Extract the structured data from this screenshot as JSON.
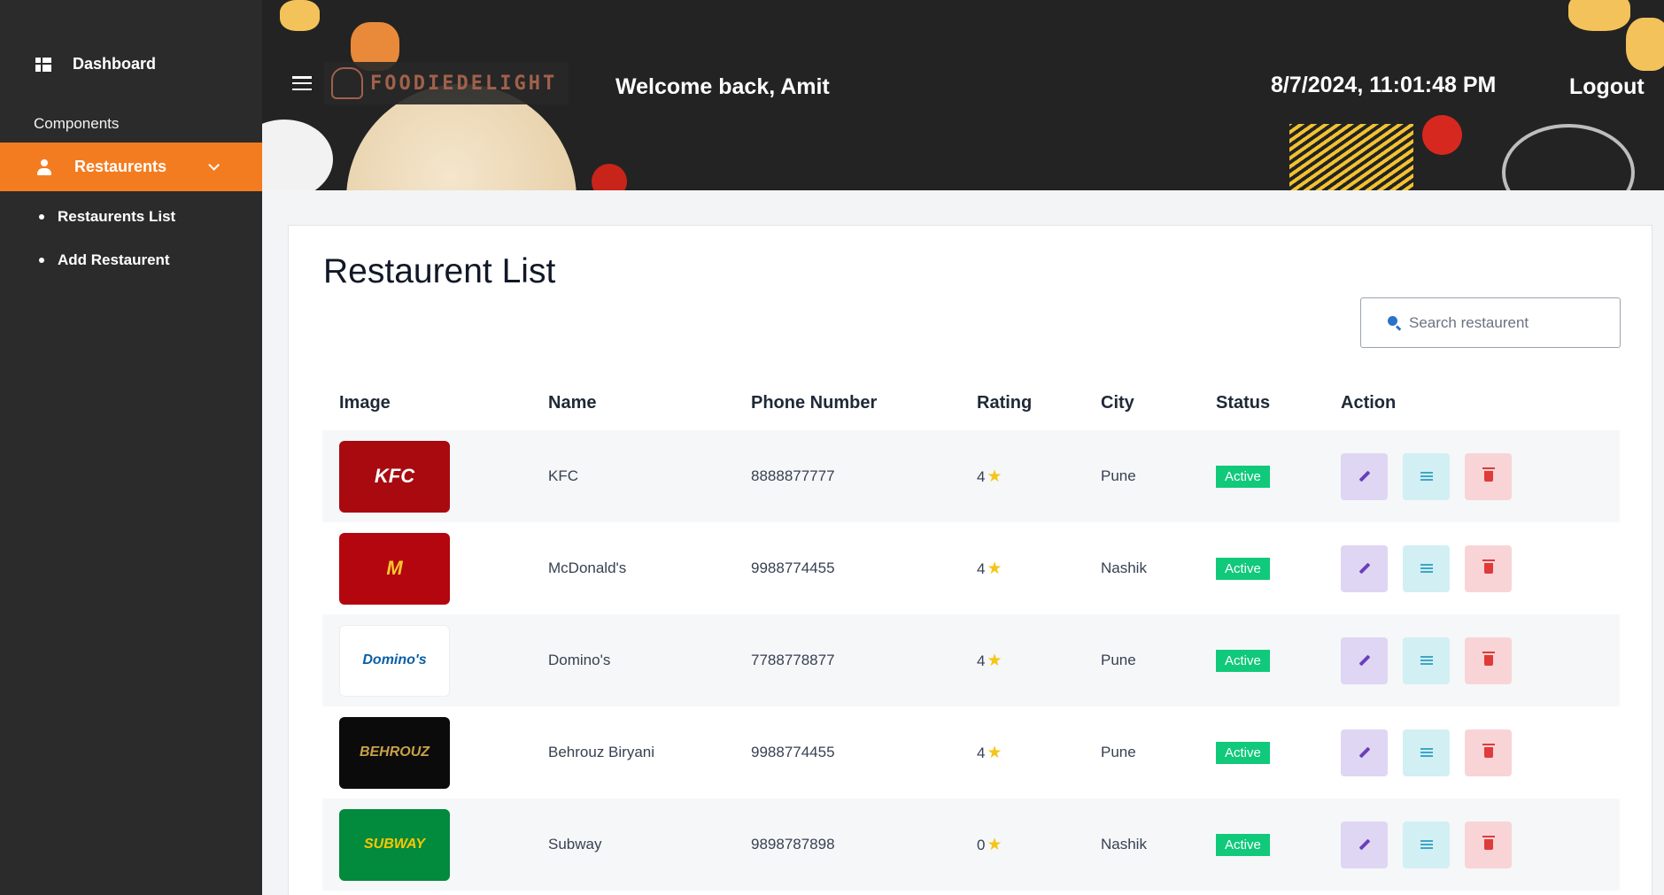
{
  "sidebar": {
    "dashboard_label": "Dashboard",
    "section_label": "Components",
    "active_label": "Restaurents",
    "sub_items": [
      {
        "label": "Restaurents List"
      },
      {
        "label": "Add Restaurent"
      }
    ]
  },
  "header": {
    "logo_text": "FOODIEDELIGHT",
    "welcome": "Welcome back, Amit",
    "datetime": "8/7/2024, 11:01:48 PM",
    "logout": "Logout"
  },
  "main": {
    "title": "Restaurent List",
    "search_placeholder": "Search restaurent",
    "columns": [
      "Image",
      "Name",
      "Phone Number",
      "Rating",
      "City",
      "Status",
      "Action"
    ],
    "rows": [
      {
        "logo_text": "KFC",
        "logo_bg": "#a80a10",
        "logo_color": "#ffffff",
        "name": "KFC",
        "phone": "8888877777",
        "rating": "4",
        "city": "Pune",
        "status": "Active"
      },
      {
        "logo_text": "M",
        "logo_bg": "#b3060f",
        "logo_color": "#ffc72c",
        "name": "McDonald's",
        "phone": "9988774455",
        "rating": "4",
        "city": "Nashik",
        "status": "Active"
      },
      {
        "logo_text": "Domino's",
        "logo_bg": "#ffffff",
        "logo_color": "#0b5fa5",
        "name": "Domino's",
        "phone": "7788778877",
        "rating": "4",
        "city": "Pune",
        "status": "Active"
      },
      {
        "logo_text": "BEHROUZ",
        "logo_bg": "#0b0b0b",
        "logo_color": "#c9a14a",
        "name": "Behrouz Biryani",
        "phone": "9988774455",
        "rating": "4",
        "city": "Pune",
        "status": "Active"
      },
      {
        "logo_text": "SUBWAY",
        "logo_bg": "#028a3d",
        "logo_color": "#ffc600",
        "name": "Subway",
        "phone": "9898787898",
        "rating": "0",
        "city": "Nashik",
        "status": "Active"
      }
    ]
  },
  "colors": {
    "sidebar_bg": "#2b2b2b",
    "accent": "#f47c20",
    "header_bg": "#232323",
    "status_active": "#10c97a"
  },
  "icons": [
    "dashboard-icon",
    "user-icon",
    "chevron-down-icon",
    "menu-icon",
    "chef-hat-icon",
    "search-icon",
    "star-icon",
    "edit-icon",
    "list-icon",
    "trash-icon"
  ]
}
